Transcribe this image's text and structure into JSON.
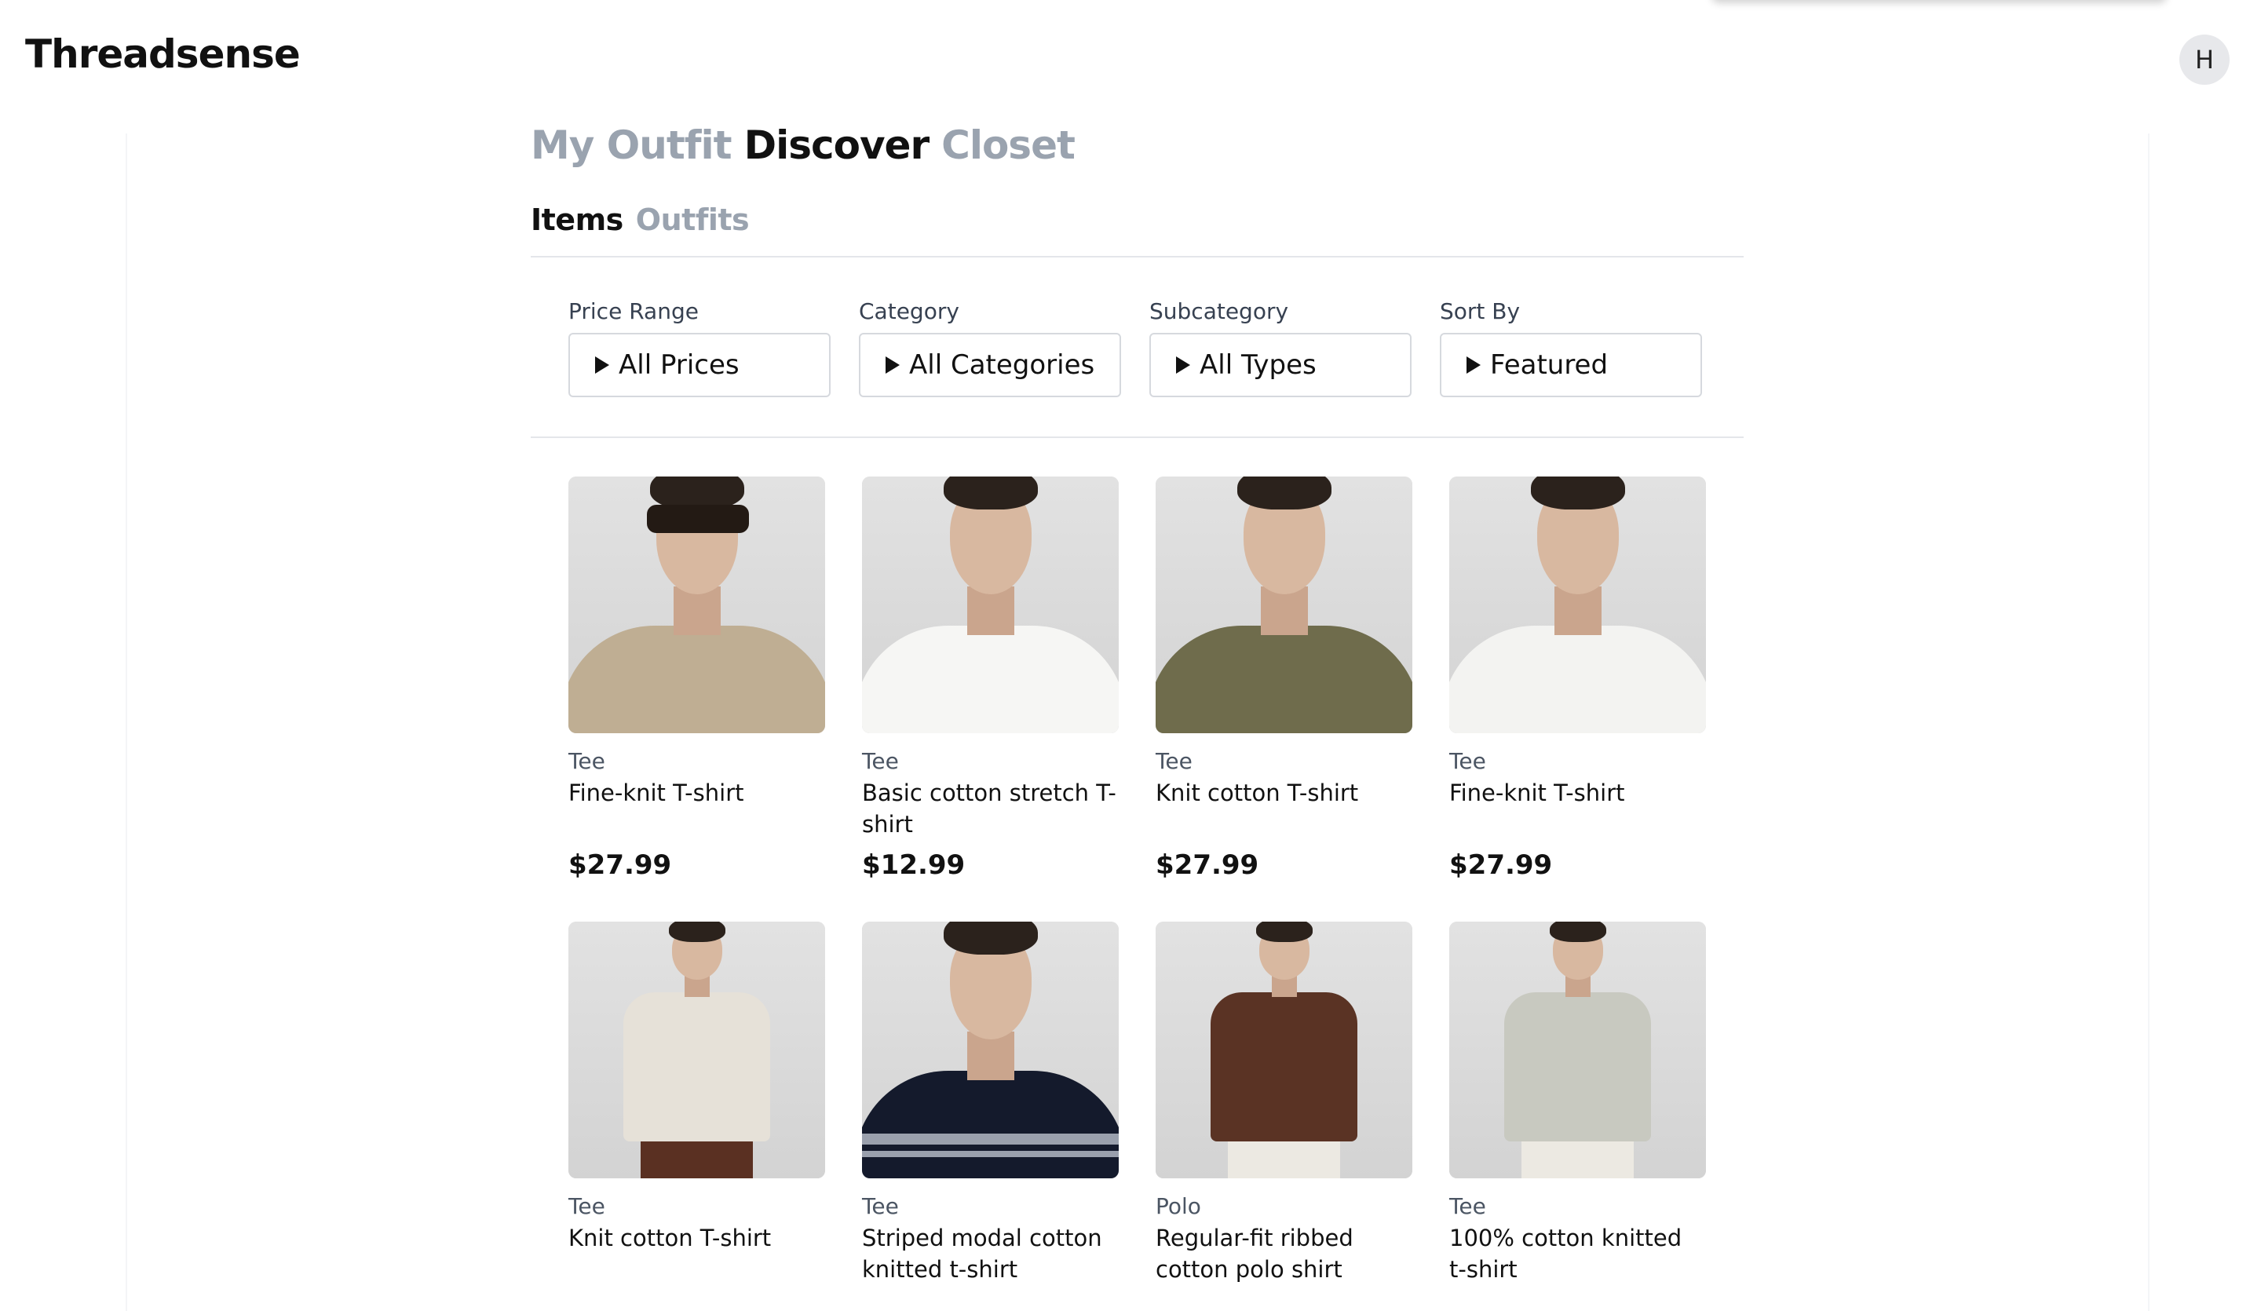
{
  "app": {
    "brand": "Threadsense",
    "avatar_initial": "H"
  },
  "main_tabs": [
    {
      "label": "My Outfit",
      "active": false
    },
    {
      "label": "Discover",
      "active": true
    },
    {
      "label": "Closet",
      "active": false
    }
  ],
  "sub_tabs": [
    {
      "label": "Items",
      "active": true
    },
    {
      "label": "Outfits",
      "active": false
    }
  ],
  "filters": [
    {
      "label": "Price Range",
      "value": "All Prices"
    },
    {
      "label": "Category",
      "value": "All Categories"
    },
    {
      "label": "Subcategory",
      "value": "All Types"
    },
    {
      "label": "Sort By",
      "value": "Featured"
    }
  ],
  "products": [
    {
      "type": "Tee",
      "name": "Fine-knit T-shirt",
      "price": "$27.99",
      "shirt_color": "#bfae93",
      "sunglasses": true
    },
    {
      "type": "Tee",
      "name": "Basic cotton stretch T-shirt",
      "price": "$12.99",
      "shirt_color": "#f6f6f4",
      "sunglasses": false
    },
    {
      "type": "Tee",
      "name": "Knit cotton T-shirt",
      "price": "$27.99",
      "shirt_color": "#6f6c4c",
      "sunglasses": false
    },
    {
      "type": "Tee",
      "name": "Fine-knit T-shirt",
      "price": "$27.99",
      "shirt_color": "#f3f3f1",
      "sunglasses": false
    },
    {
      "type": "Tee",
      "name": "Knit cotton T-shirt",
      "price": "",
      "shirt_color": "#e6e1d8",
      "sunglasses": true
    },
    {
      "type": "Tee",
      "name": "Striped modal cotton knitted t-shirt",
      "price": "",
      "shirt_color": "#141a2c",
      "sunglasses": false
    },
    {
      "type": "Polo",
      "name": "Regular-fit ribbed cotton polo shirt",
      "price": "",
      "shirt_color": "#5a3324",
      "sunglasses": false
    },
    {
      "type": "Tee",
      "name": "100% cotton knitted t-shirt",
      "price": "",
      "shirt_color": "#c8c9c0",
      "sunglasses": false
    }
  ]
}
